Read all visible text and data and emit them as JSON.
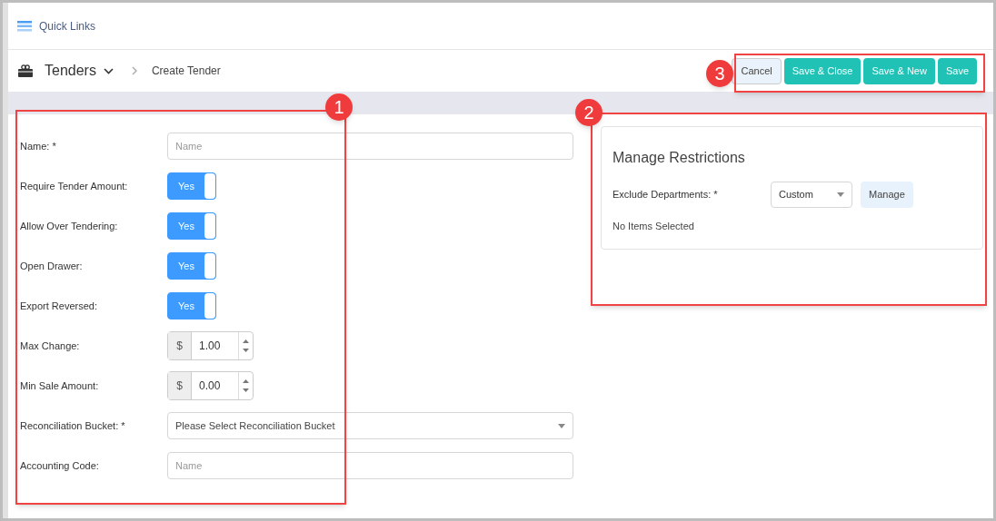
{
  "quick_links": {
    "label": "Quick Links"
  },
  "breadcrumb": {
    "section": "Tenders",
    "page": "Create Tender"
  },
  "actions": [
    {
      "label": "Cancel",
      "kind": "secondary"
    },
    {
      "label": "Save & Close",
      "kind": "primary"
    },
    {
      "label": "Save & New",
      "kind": "primary"
    },
    {
      "label": "Save",
      "kind": "primary"
    }
  ],
  "form": [
    {
      "kind": "text",
      "label": "Name: *",
      "placeholder": "Name"
    },
    {
      "kind": "toggle",
      "label": "Require Tender Amount:",
      "on": true,
      "text": "Yes"
    },
    {
      "kind": "toggle",
      "label": "Allow Over Tendering:",
      "on": true,
      "text": "Yes"
    },
    {
      "kind": "toggle",
      "label": "Open Drawer:",
      "on": true,
      "text": "Yes"
    },
    {
      "kind": "toggle",
      "label": "Export Reversed:",
      "on": true,
      "text": "Yes"
    },
    {
      "kind": "money",
      "label": "Max Change:",
      "prefix": "$",
      "value": "1.00"
    },
    {
      "kind": "money",
      "label": "Min Sale Amount:",
      "prefix": "$",
      "value": "0.00"
    },
    {
      "kind": "select",
      "label": "Reconciliation Bucket: *",
      "value": "Please Select Reconciliation Bucket"
    },
    {
      "kind": "text",
      "label": "Accounting Code:",
      "placeholder": "Name"
    }
  ],
  "restrictions": {
    "title": "Manage Restrictions",
    "label": "Exclude Departments: *",
    "select": "Custom",
    "button": "Manage",
    "empty": "No Items Selected"
  },
  "annotations": [
    "1",
    "2",
    "3"
  ]
}
